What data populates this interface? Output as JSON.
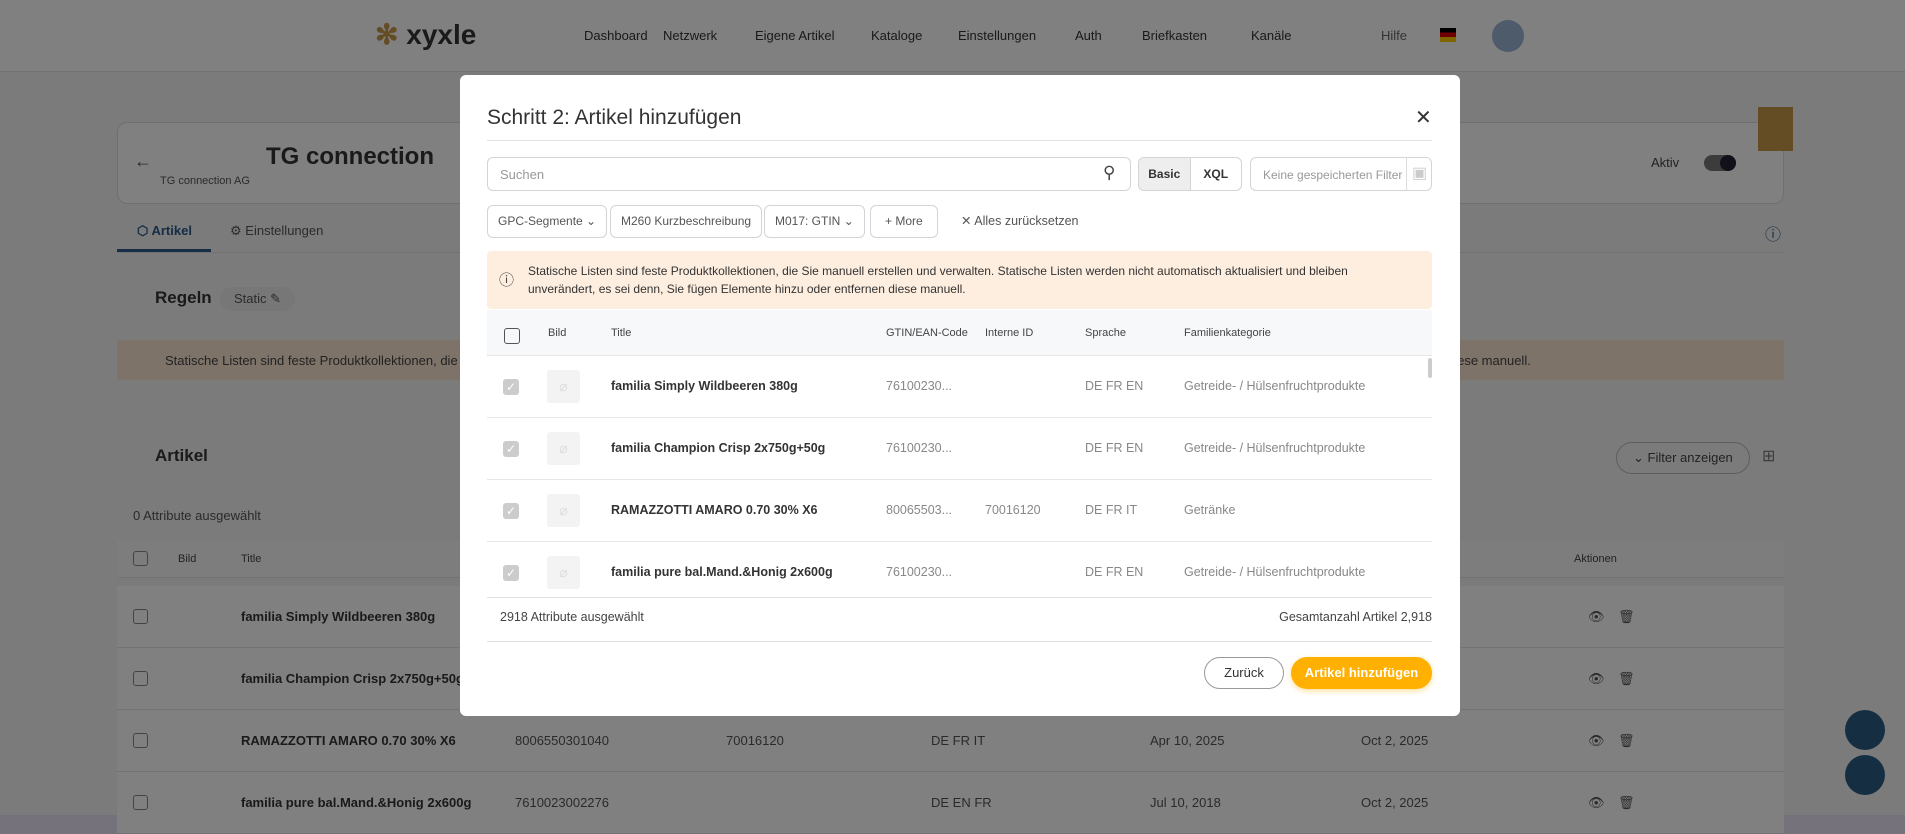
{
  "header": {
    "logo": "xyxle",
    "nav": [
      "Dashboard",
      "Netzwerk",
      "Eigene Artikel",
      "Kataloge",
      "Einstellungen",
      "Auth",
      "Briefkasten",
      "Kanäle"
    ],
    "help": "Hilfe"
  },
  "page": {
    "title": "TG connection",
    "subtitle": "TG connection AG",
    "active_label": "Aktiv",
    "tabs": [
      "Artikel",
      "Einstellungen"
    ],
    "rules_title": "Regeln",
    "static_label": "Static",
    "banner": "Statische Listen sind feste Produktkollektionen, die Sie manuell erstellen und verwalten. Statische Listen werden nicht automatisch aktualisiert und bleiben unverändert, es sei denn, Sie fügen Elemente hinzu oder entfernen diese manuell.",
    "articles_title": "Artikel",
    "filter_button": "Filter anzeigen",
    "selected": "0 Attribute ausgewählt",
    "columns": {
      "bild": "Bild",
      "title": "Title",
      "actions": "Aktionen"
    },
    "rows": [
      {
        "title": "familia Simply Wildbeeren 380g",
        "gtin": "",
        "id": "",
        "lang": "",
        "created": "",
        "updated": ""
      },
      {
        "title": "familia Champion Crisp 2x750g+50g",
        "gtin": "",
        "id": "",
        "lang": "",
        "created": "",
        "updated": ""
      },
      {
        "title": "RAMAZZOTTI AMARO 0.70 30% X6",
        "gtin": "8006550301040",
        "id": "70016120",
        "lang": "DE FR IT",
        "created": "Apr 10, 2025",
        "updated": "Oct 2, 2025"
      },
      {
        "title": "familia pure bal.Mand.&Honig 2x600g",
        "gtin": "7610023002276",
        "id": "",
        "lang": "DE EN FR",
        "created": "Jul 10, 2018",
        "updated": "Oct 2, 2025"
      }
    ]
  },
  "modal": {
    "title": "Schritt 2: Artikel hinzufügen",
    "search_placeholder": "Suchen",
    "mode_basic": "Basic",
    "mode_xql": "XQL",
    "saved_filter_placeholder": "Keine gespeicherten Filter",
    "chips": [
      "GPC-Segmente",
      "M260 Kurzbeschreibung",
      "M017: GTIN",
      "More"
    ],
    "reset": "Alles zurücksetzen",
    "info": "Statische Listen sind feste Produktkollektionen, die Sie manuell erstellen und verwalten. Statische Listen werden nicht automatisch aktualisiert und bleiben unverändert, es sei denn, Sie fügen Elemente hinzu oder entfernen diese manuell.",
    "columns": {
      "bild": "Bild",
      "title": "Title",
      "gtin": "GTIN/EAN-Code",
      "id": "Interne ID",
      "lang": "Sprache",
      "family": "Familienkategorie"
    },
    "rows": [
      {
        "title": "familia Simply Wildbeeren 380g",
        "gtin": "76100230...",
        "id": "",
        "lang": "DE FR EN",
        "family": "Getreide- / Hülsenfruchtprodukte"
      },
      {
        "title": "familia Champion Crisp 2x750g+50g",
        "gtin": "76100230...",
        "id": "",
        "lang": "DE FR EN",
        "family": "Getreide- / Hülsenfruchtprodukte"
      },
      {
        "title": "RAMAZZOTTI AMARO 0.70 30% X6",
        "gtin": "80065503...",
        "id": "70016120",
        "lang": "DE FR IT",
        "family": "Getränke"
      },
      {
        "title": "familia pure bal.Mand.&Honig 2x600g",
        "gtin": "76100230...",
        "id": "",
        "lang": "DE FR EN",
        "family": "Getreide- / Hülsenfruchtprodukte"
      }
    ],
    "selected": "2918 Attribute ausgewählt",
    "total": "Gesamtanzahl Artikel 2,918",
    "back": "Zurück",
    "submit": "Artikel hinzufügen",
    "accent": "#ffb000"
  }
}
